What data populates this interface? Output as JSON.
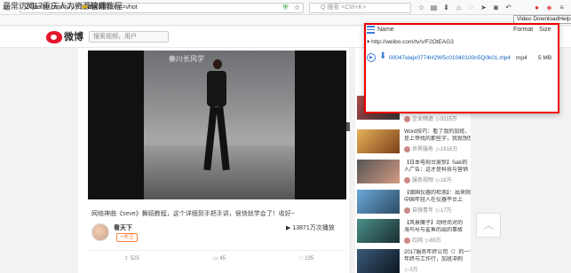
{
  "browser": {
    "url": "weibo.com/tv/v/F2OtEAG3?from=vhot",
    "search_placeholder": "Q 搜索 <Ctrl+K>",
    "bookmarks": [
      "最常访问",
      "2017重庆人力资源管理...",
      "软件教程"
    ],
    "tooltip": "Video DownloadHelper Pro"
  },
  "weibo": {
    "logo_text": "微博",
    "search_placeholder": "搜索视频，用户",
    "video_overlay_text": "秦川长风学",
    "caption": "网络神曲《seve》舞蹈教程，这个详细到手把手讲，很快就学会了！收好~",
    "author_name": "看天下",
    "follow_label": "+关注",
    "play_count": "13871万次播放",
    "actions": [
      {
        "icon": "share-icon",
        "count": "525"
      },
      {
        "icon": "comment-icon",
        "count": "45"
      },
      {
        "icon": "like-icon",
        "count": "135"
      }
    ],
    "to_top_icon": "chevron-up-icon"
  },
  "recommendations": [
    {
      "title": "",
      "author": "企业频道",
      "views": "3115万"
    },
    {
      "title": "Word技巧：看了我的加班，千",
      "title2": "是上帝找的那些字，我就想想",
      "author": "世界服务",
      "views": "1916万"
    },
    {
      "title": "【日本电视台震惊】Saki的",
      "title2": "人广告：这才是科技与营销",
      "author": "服务视频",
      "views": "18万"
    },
    {
      "title": "【德国仪器的检测】：出来刚刚",
      "title2": "中国年轻人在仪器平台上",
      "author": "自强青年",
      "views": "17万"
    },
    {
      "title": "【风景魔子】动时尚对的",
      "title2": "海鸟号与鲨鱼的出的事故",
      "author": "红网",
      "views": "69万"
    },
    {
      "title": "2017服务年终公司（）的一个，参加",
      "title2": "年终与工作行，加班冲刺",
      "author": "",
      "views": "3万"
    }
  ],
  "downloader": {
    "columns": {
      "name": "Name",
      "format": "Format",
      "size": "Size"
    },
    "page_url": "http://weibo.com/tv/v/F2OtEAG3",
    "file": {
      "name": "00047elajx0774H2W5c01040100n5Q0k01.mp4",
      "format": "mp4",
      "size": "5 MB"
    }
  },
  "colors": {
    "accent": "#e00000",
    "link": "#1565c0",
    "weibo_orange": "#ff8140"
  }
}
